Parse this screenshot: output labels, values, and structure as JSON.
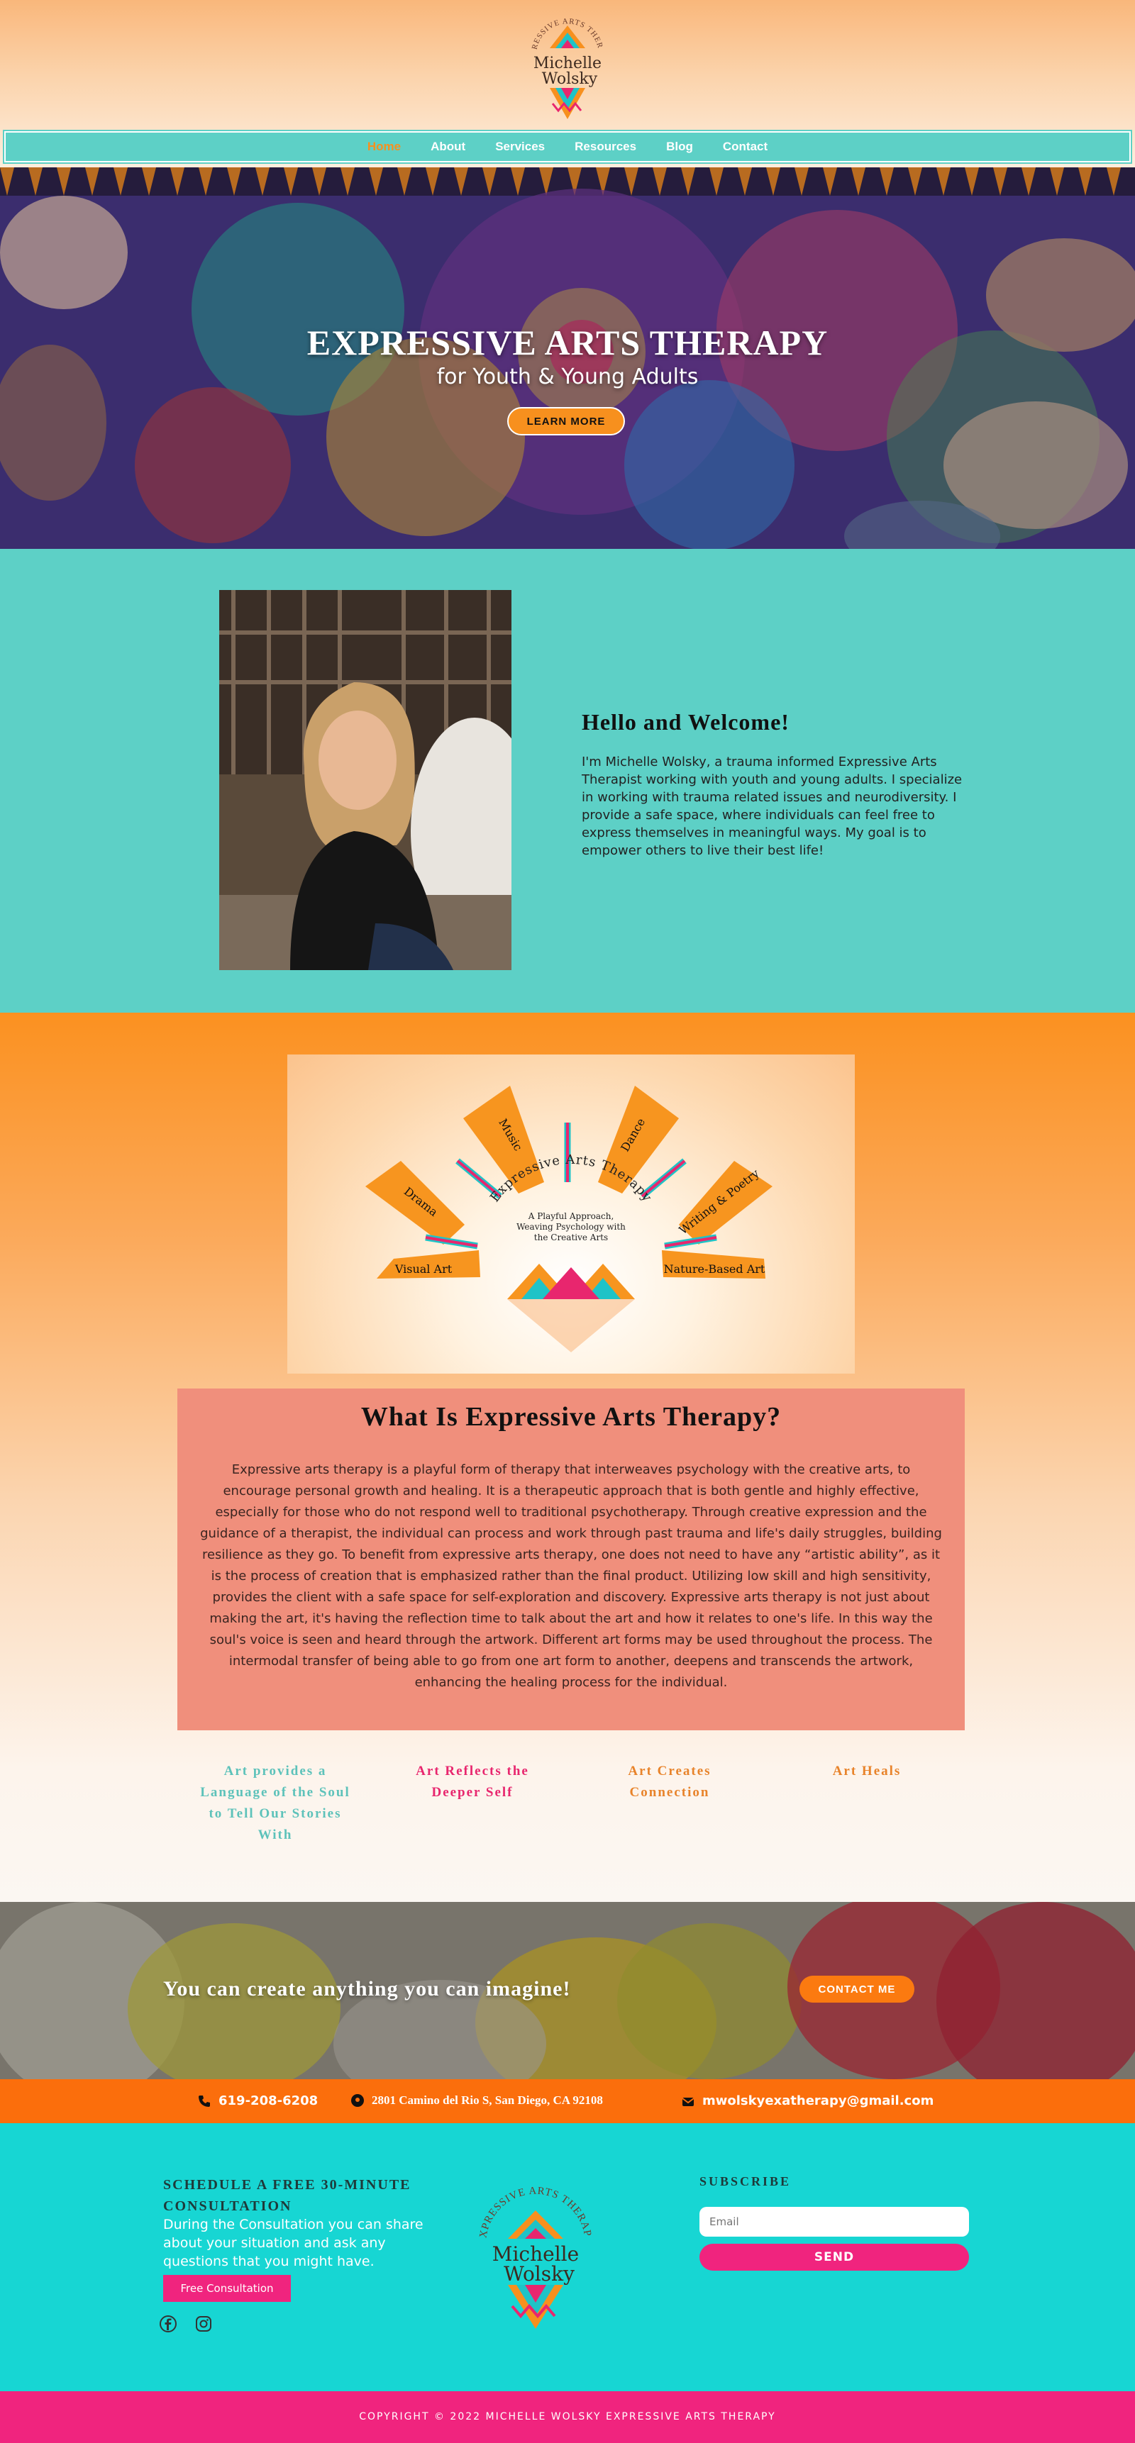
{
  "brand": {
    "arc_text": "EXPRESSIVE ARTS THERAPY",
    "name_line1": "Michelle",
    "name_line2": "Wolsky"
  },
  "nav": {
    "items": [
      {
        "label": "Home",
        "active": true
      },
      {
        "label": "About",
        "active": false
      },
      {
        "label": "Services",
        "active": false
      },
      {
        "label": "Resources",
        "active": false
      },
      {
        "label": "Blog",
        "active": false
      },
      {
        "label": "Contact",
        "active": false
      }
    ]
  },
  "hero": {
    "title": "EXPRESSIVE ARTS THERAPY",
    "subtitle": "for Youth & Young Adults",
    "button_label": "LEARN MORE"
  },
  "welcome": {
    "title": "Hello and Welcome!",
    "text": "I'm Michelle Wolsky, a trauma informed Expressive Arts Therapist working with youth and young adults. I specialize in working with trauma related issues and neurodiversity. I provide a safe space, where individuals can feel free to express themselves in meaningful ways. My goal is to empower others to live their best life!"
  },
  "diagram": {
    "rays": [
      "Visual Art",
      "Drama",
      "Music",
      "Dance",
      "Writing & Poetry",
      "Nature-Based Art"
    ],
    "arc_title": "Expressive Arts Therapy",
    "caption_line1": "A Playful Approach,",
    "caption_line2": "Weaving Psychology with",
    "caption_line3": "the Creative Arts"
  },
  "what": {
    "title": "What Is Expressive Arts Therapy?",
    "text": "Expressive arts therapy is a playful form of therapy that interweaves psychology with the creative arts, to encourage personal growth and healing. It is a therapeutic approach that is both gentle and highly effective, especially for those who do not respond well to traditional psychotherapy. Through creative expression and the guidance of a therapist, the individual can process and work through past trauma and life's daily struggles, building resilience as they go. To benefit from expressive arts therapy, one does not need to have any “artistic ability”, as it is the process of creation that is emphasized rather than the final product. Utilizing low skill and high sensitivity, provides the client with a safe space for self-exploration and discovery. Expressive arts therapy is not just about making the art, it's having the reflection time to talk about the art and how it relates to one's life. In this way the soul's voice is seen and heard through the artwork. Different art forms may be used throughout the process. The intermodal transfer of being able to go from one art form to another, deepens and transcends the artwork, enhancing the healing process for the individual."
  },
  "taglines": [
    "Art provides a Language of the Soul to Tell Our Stories With",
    "Art Reflects the Deeper Self",
    "Art Creates Connection",
    "Art Heals"
  ],
  "cta": {
    "text": "You can create anything you can imagine!",
    "button_label": "CONTACT ME"
  },
  "contact": {
    "phone": "619-208-6208",
    "address": "2801 Camino del Rio S, San Diego, CA 92108",
    "email": "mwolskyexatherapy@gmail.com"
  },
  "footer": {
    "schedule_title": "SCHEDULE A FREE 30-MINUTE CONSULTATION",
    "schedule_text": "During the Consultation you can share about your situation and ask any questions that you might have.",
    "consult_button": "Free Consultation",
    "social_icons": [
      "facebook-icon",
      "instagram-icon"
    ],
    "subscribe_title": "SUBSCRIBE",
    "email_placeholder": "Email",
    "send_button": "SEND",
    "copyright": "COPYRIGHT © 2022 MICHELLE WOLSKY EXPRESSIVE ARTS THERAPY"
  },
  "colors": {
    "teal": "#5dd0c6",
    "footer_teal": "#17d6d3",
    "orange": "#f7901e",
    "contact_orange": "#fb6e0c",
    "pink": "#f0247e",
    "salmon": "#f08f7c"
  }
}
